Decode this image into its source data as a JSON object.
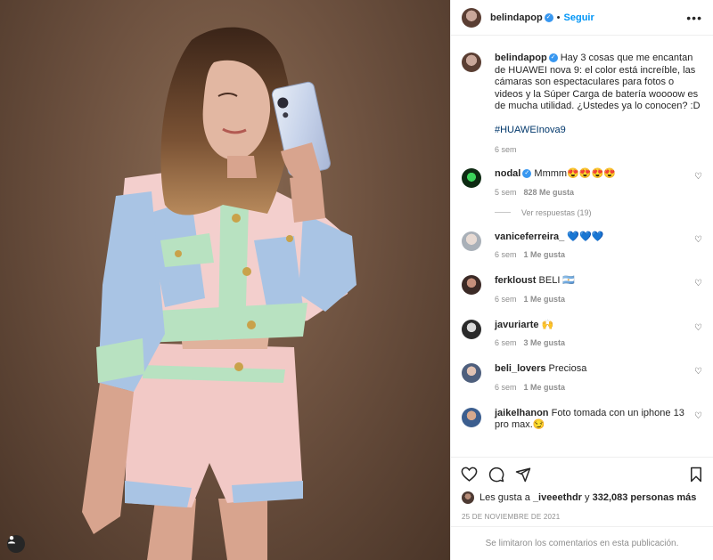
{
  "post": {
    "author": "belindapop",
    "follow_label": "Seguir",
    "more_label": "•••",
    "caption": "Hay 3 cosas que me encantan de HUAWEI nova 9: el color está increíble, las cámaras son espectaculares para fotos o videos y la Súper Carga de batería woooow es de mucha utilidad. ¿Ustedes ya lo conocen? :D",
    "hashtag": "#HUAWEInova9",
    "caption_time": "6 sem"
  },
  "comments": [
    {
      "user": "nodal",
      "verified": true,
      "text": "Mmmm😍😍😍😍",
      "time": "5 sem",
      "likes": "828 Me gusta",
      "replies": "Ver respuestas (19)"
    },
    {
      "user": "vaniceferreira_",
      "verified": false,
      "text": "💙💙💙",
      "time": "6 sem",
      "likes": "1 Me gusta"
    },
    {
      "user": "ferkloust",
      "verified": false,
      "text": "BELI 🇦🇷",
      "time": "6 sem",
      "likes": "1 Me gusta"
    },
    {
      "user": "javuriarte",
      "verified": false,
      "text": "🙌",
      "time": "6 sem",
      "likes": "3 Me gusta"
    },
    {
      "user": "beli_lovers",
      "verified": false,
      "text": "Preciosa",
      "time": "6 sem",
      "likes": "1 Me gusta"
    },
    {
      "user": "jaikelhanon",
      "verified": false,
      "text": "Foto tomada con un iphone 13 pro max.😏"
    }
  ],
  "likes_line": {
    "prefix": "Les gusta a",
    "user": "_iveeethdr",
    "middle": "y",
    "count": "332,083 personas más"
  },
  "date": "25 DE NOVIEMBRE DE 2021",
  "limited_notice": "Se limitaron los comentarios en esta publicación.",
  "icons": [
    "heart-icon",
    "comment-icon",
    "share-icon",
    "bookmark-icon",
    "user-tag-icon",
    "more-icon"
  ]
}
